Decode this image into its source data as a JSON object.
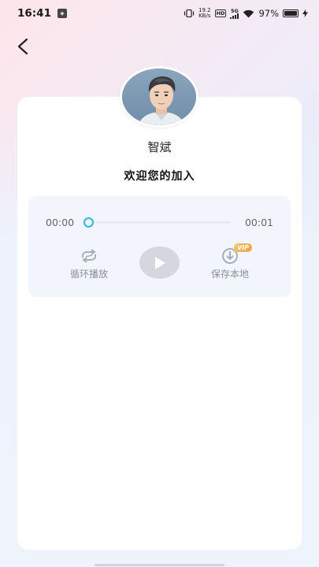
{
  "status_bar": {
    "time": "16:41",
    "net_speed_value": "19.2",
    "net_speed_unit": "KB/s",
    "hd_label": "HD",
    "network_type": "5G",
    "battery_percent": "97%",
    "battery_level": 0.97
  },
  "profile": {
    "name": "智斌",
    "welcome_text": "欢迎您的加入"
  },
  "player": {
    "current_time": "00:00",
    "total_time": "00:01",
    "progress": 0,
    "loop_label": "循环播放",
    "save_label": "保存本地",
    "vip_badge": "VIP"
  },
  "colors": {
    "accent": "#2fb7e6",
    "vip": "#f3a54a",
    "play_button": "#d4d7de"
  }
}
